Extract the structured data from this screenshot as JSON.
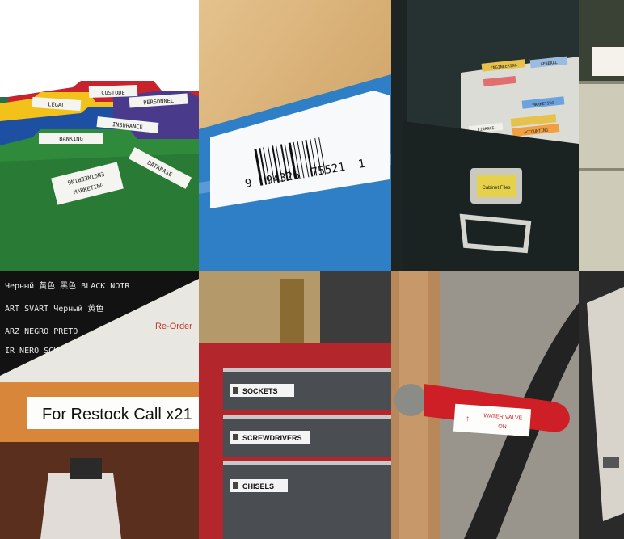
{
  "tiles": {
    "folders": {
      "labels": [
        "CUSTODE",
        "LEGAL",
        "PERSONNEL",
        "INSURANCE",
        "BANKING",
        "DATABASE",
        "ENGINEERING",
        "MARKETING"
      ]
    },
    "barcode": {
      "digits_left": "9",
      "digits_mid": "94326",
      "digits_right": "75521",
      "digits_end": "1"
    },
    "cabinet": {
      "folder_tabs": [
        "ENGINEERING",
        "GENERAL",
        "MARKETING",
        "FINANCE",
        "ACCOUNTING"
      ],
      "drawer_label": "Cabinet Files"
    },
    "restock": {
      "multilang_rows": [
        "Черный 黄色 黑色 BLACK NOIR",
        "ART SVART Черный 黄色",
        "ARZ NEGRO PRETO",
        "IR NERO SCH"
      ],
      "reorder": "Re-Order",
      "shelf_label": "For Restock Call x21"
    },
    "toolbox": {
      "drawers": [
        "SOCKETS",
        "SCREWDRIVERS",
        "CHISELS"
      ]
    },
    "valve": {
      "tag_line1": "WATER VALVE",
      "tag_line2": "ON"
    }
  },
  "colors": {
    "folder_red": "#c8232c",
    "folder_yellow": "#f2c21a",
    "folder_blue": "#1d4fa3",
    "folder_purple": "#4a3a8c",
    "folder_green": "#2f8a3b",
    "wood": "#d9b37a",
    "blue_folder": "#2f7fc6",
    "cabinet_dark": "#1f2a2a",
    "toolbox_red": "#b3262b",
    "valve_red": "#cf1f26",
    "shelf_orange": "#d8873a"
  }
}
